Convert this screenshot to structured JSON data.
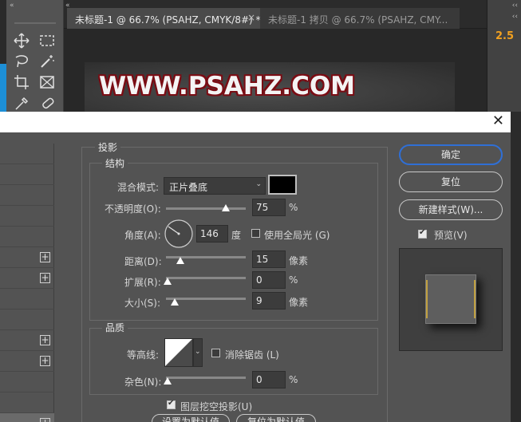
{
  "tabs": [
    {
      "label": "未标题-1 @ 66.7% (PSAHZ, CMYK/8#) *"
    },
    {
      "label": "未标题-1 拷贝 @ 66.7% (PSAHZ, CMY..."
    }
  ],
  "canvas": {
    "text": "WWW.PSAHZ.COM"
  },
  "right_panel": {
    "value": "2.5"
  },
  "icons": [
    "move-icon",
    "marquee-icon",
    "lasso-icon",
    "magic-wand-icon",
    "crop-icon",
    "frame-icon",
    "eyedropper-icon",
    "healing-brush-icon"
  ],
  "dialog": {
    "section_title": "投影",
    "structure": {
      "title": "结构",
      "blend_mode_label": "混合模式:",
      "blend_mode_value": "正片叠底",
      "shadow_color": "#000000",
      "opacity_label": "不透明度(O):",
      "opacity_value": "75",
      "opacity_unit": "%",
      "angle_label": "角度(A):",
      "angle_value": "146",
      "angle_unit": "度",
      "global_light_label": "使用全局光 (G)",
      "global_light_checked": false,
      "distance_label": "距离(D):",
      "distance_value": "15",
      "distance_unit": "像素",
      "spread_label": "扩展(R):",
      "spread_value": "0",
      "spread_unit": "%",
      "size_label": "大小(S):",
      "size_value": "9",
      "size_unit": "像素"
    },
    "quality": {
      "title": "品质",
      "contour_label": "等高线:",
      "antialias_label": "消除锯齿 (L)",
      "antialias_checked": false,
      "noise_label": "杂色(N):",
      "noise_value": "0",
      "noise_unit": "%"
    },
    "knockout_label": "图层挖空投影(U)",
    "knockout_checked": true,
    "buttons": {
      "ok": "确定",
      "reset": "复位",
      "new_style": "新建样式(W)...",
      "preview_label": "预览(V)",
      "preview_checked": true
    },
    "bottom_buttons": [
      "设置为默认值",
      "复位为默认值"
    ]
  }
}
